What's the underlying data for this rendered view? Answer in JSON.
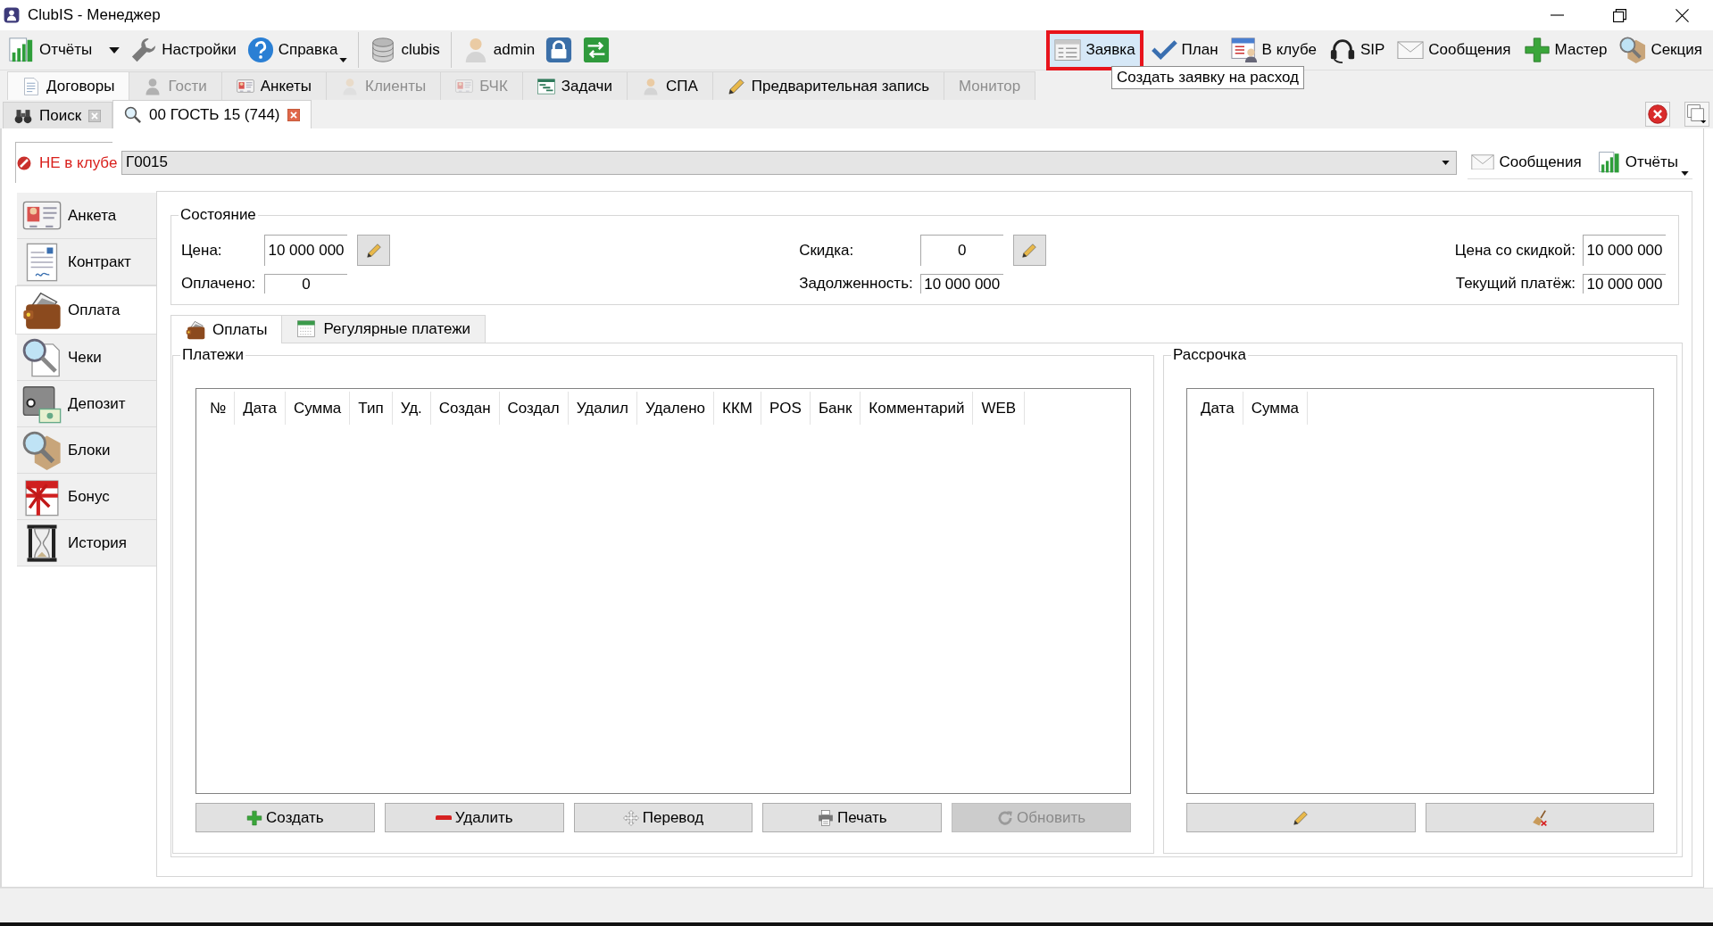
{
  "window": {
    "title": "ClubIS - Менеджер"
  },
  "toolbar": {
    "left_groups": [
      [
        {
          "kind": "menu",
          "label": "Отчёты"
        },
        {
          "kind": "button",
          "label": "Настройки"
        },
        {
          "kind": "split",
          "label": "Справка"
        }
      ],
      [
        {
          "kind": "button",
          "label": "clubis"
        }
      ],
      [
        {
          "kind": "button",
          "label": "admin"
        },
        {
          "kind": "icon"
        },
        {
          "kind": "icon"
        }
      ]
    ],
    "right": [
      {
        "label": "Заявка",
        "hovered": true,
        "highlighted": true
      },
      {
        "label": "План",
        "hovered": false,
        "highlighted": false
      },
      {
        "label": "В клубе",
        "hovered": false,
        "highlighted": false
      },
      {
        "label": "SIP",
        "hovered": false,
        "highlighted": false
      },
      {
        "label": "Сообщения",
        "hovered": false,
        "highlighted": false
      },
      {
        "label": "Мастер",
        "hovered": false,
        "highlighted": false
      },
      {
        "label": "Секция",
        "hovered": false,
        "highlighted": false
      }
    ]
  },
  "tooltip": {
    "text": "Создать заявку на расход"
  },
  "tabs": [
    {
      "label": "Договоры",
      "selected": true,
      "disabled": false
    },
    {
      "label": "Гости",
      "selected": false,
      "disabled": true
    },
    {
      "label": "Анкеты",
      "selected": false,
      "disabled": false
    },
    {
      "label": "Клиенты",
      "selected": false,
      "disabled": true
    },
    {
      "label": "БЧК",
      "selected": false,
      "disabled": true
    },
    {
      "label": "Задачи",
      "selected": false,
      "disabled": false
    },
    {
      "label": "СПА",
      "selected": false,
      "disabled": false
    },
    {
      "label": "Предварительная запись",
      "selected": false,
      "disabled": false
    },
    {
      "label": "Монитор",
      "selected": false,
      "disabled": true
    }
  ],
  "documents": [
    {
      "label": "Поиск",
      "selected": false
    },
    {
      "label": "00 ГОСТЬ 15 (744)",
      "selected": true
    }
  ],
  "client": {
    "status": "НЕ в клубе",
    "value": "Г0015",
    "buttons": [
      {
        "kind": "button",
        "label": "Сообщения"
      },
      {
        "kind": "split",
        "label": "Отчёты"
      }
    ]
  },
  "sidebar": {
    "items": [
      {
        "label": "Анкета",
        "selected": false
      },
      {
        "label": "Контракт",
        "selected": false
      },
      {
        "label": "Оплата",
        "selected": true
      },
      {
        "label": "Чеки",
        "selected": false
      },
      {
        "label": "Депозит",
        "selected": false
      },
      {
        "label": "Блоки",
        "selected": false
      },
      {
        "label": "Бонус",
        "selected": false
      },
      {
        "label": "История",
        "selected": false
      }
    ]
  },
  "state": {
    "title": "Состояние",
    "columns": [
      [
        {
          "label": "Цена:",
          "value": "10 000 000",
          "kind": "edit"
        },
        {
          "label": "Оплачено:",
          "value": "0",
          "kind": "plain"
        }
      ],
      [
        {
          "label": "Скидка:",
          "value": "0",
          "kind": "edit"
        },
        {
          "label": "Задолженность:",
          "value": "10 000 000",
          "kind": "plain"
        }
      ],
      [
        {
          "label": "Цена со скидкой:",
          "value": "10 000 000",
          "kind": "plain"
        },
        {
          "label": "Текущий платёж:",
          "value": "10 000 000",
          "kind": "plain"
        }
      ]
    ]
  },
  "inner_tabs": [
    {
      "label": "Оплаты",
      "selected": true
    },
    {
      "label": "Регулярные платежи",
      "selected": false
    }
  ],
  "payments": {
    "title": "Платежи",
    "columns": [
      "№",
      "Дата",
      "Сумма",
      "Тип",
      "Уд.",
      "Создан",
      "Создал",
      "Удалил",
      "Удалено",
      "ККМ",
      "POS",
      "Банк",
      "Комментарий",
      "WEB"
    ],
    "buttons": [
      {
        "label": "Создать",
        "disabled": false
      },
      {
        "label": "Удалить",
        "disabled": false
      },
      {
        "label": "Перевод",
        "disabled": false
      },
      {
        "label": "Печать",
        "disabled": false
      },
      {
        "label": "Обновить",
        "disabled": true
      }
    ]
  },
  "installments": {
    "title": "Рассрочка",
    "columns": [
      "Дата",
      "Сумма"
    ],
    "buttons": [
      {
        "disabled": false
      },
      {
        "disabled": false
      }
    ]
  }
}
